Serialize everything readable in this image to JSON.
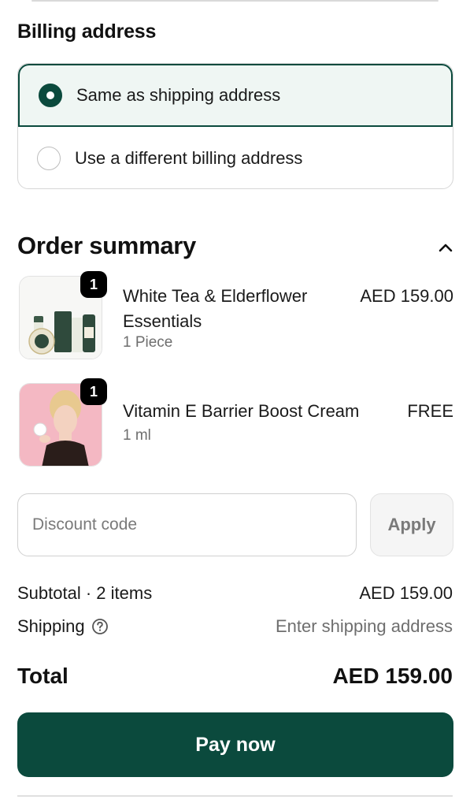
{
  "billing": {
    "title": "Billing address",
    "options": [
      {
        "label": "Same as shipping address",
        "selected": true
      },
      {
        "label": "Use a different billing address",
        "selected": false
      }
    ]
  },
  "summary": {
    "title": "Order summary",
    "toggle_icon": "chevron-up-icon",
    "items": [
      {
        "name": "White Tea & Elderflower Essentials",
        "variant": "1 Piece",
        "price": "AED 159.00",
        "quantity": "1"
      },
      {
        "name": "Vitamin E Barrier Boost Cream",
        "variant": "1 ml",
        "price": "FREE",
        "quantity": "1"
      }
    ]
  },
  "discount": {
    "placeholder": "Discount code",
    "value": "",
    "apply_label": "Apply"
  },
  "totals": {
    "subtotal_label": "Subtotal · 2 items",
    "subtotal_value": "AED 159.00",
    "shipping_label": "Shipping",
    "shipping_value": "Enter shipping address",
    "total_label": "Total",
    "total_value": "AED 159.00"
  },
  "pay_button": "Pay now",
  "colors": {
    "accent": "#0b4a3d",
    "selected_bg": "#eff6f3",
    "muted_text": "#6e6e6e"
  }
}
